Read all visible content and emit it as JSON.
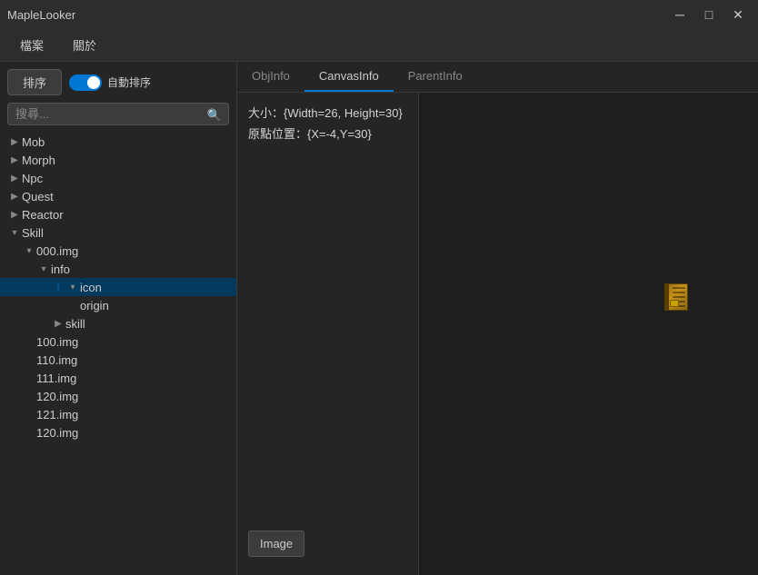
{
  "app": {
    "title": "MapleLooker",
    "minimize_label": "─",
    "maximize_label": "□",
    "close_label": "✕"
  },
  "menubar": {
    "items": [
      {
        "label": "檔案"
      },
      {
        "label": "關於"
      }
    ]
  },
  "toolbar": {
    "sort_button": "排序",
    "auto_sort_label": "自動排序"
  },
  "search": {
    "placeholder": "搜尋..."
  },
  "tree": {
    "items": [
      {
        "id": "mob",
        "label": "Mob",
        "indent": 0,
        "arrow": "▶",
        "expanded": false
      },
      {
        "id": "morph",
        "label": "Morph",
        "indent": 0,
        "arrow": "▶",
        "expanded": false
      },
      {
        "id": "npc",
        "label": "Npc",
        "indent": 0,
        "arrow": "▶",
        "expanded": false
      },
      {
        "id": "quest",
        "label": "Quest",
        "indent": 0,
        "arrow": "▶",
        "expanded": false
      },
      {
        "id": "reactor",
        "label": "Reactor",
        "indent": 0,
        "arrow": "▶",
        "expanded": false
      },
      {
        "id": "skill",
        "label": "Skill",
        "indent": 0,
        "arrow": "▾",
        "expanded": true
      },
      {
        "id": "000img",
        "label": "000.img",
        "indent": 1,
        "arrow": "▾",
        "expanded": true
      },
      {
        "id": "info",
        "label": "info",
        "indent": 2,
        "arrow": "▾",
        "expanded": true
      },
      {
        "id": "icon",
        "label": "icon",
        "indent": 3,
        "arrow": "▾",
        "expanded": true,
        "selected": true
      },
      {
        "id": "origin",
        "label": "origin",
        "indent": 4,
        "arrow": "",
        "expanded": false
      },
      {
        "id": "skill2",
        "label": "skill",
        "indent": 3,
        "arrow": "▶",
        "expanded": false
      },
      {
        "id": "100img",
        "label": "100.img",
        "indent": 1,
        "arrow": "",
        "expanded": false
      },
      {
        "id": "110img",
        "label": "110.img",
        "indent": 1,
        "arrow": "",
        "expanded": false
      },
      {
        "id": "111img",
        "label": "111.img",
        "indent": 1,
        "arrow": "",
        "expanded": false
      },
      {
        "id": "120img",
        "label": "120.img",
        "indent": 1,
        "arrow": "",
        "expanded": false
      },
      {
        "id": "121img",
        "label": "121.img",
        "indent": 1,
        "arrow": "",
        "expanded": false
      },
      {
        "id": "130img",
        "label": "120.img",
        "indent": 1,
        "arrow": "",
        "expanded": false
      }
    ]
  },
  "tabs": {
    "items": [
      {
        "id": "objinfo",
        "label": "ObjInfo"
      },
      {
        "id": "canvasinfo",
        "label": "CanvasInfo",
        "active": true
      },
      {
        "id": "parentinfo",
        "label": "ParentInfo"
      }
    ]
  },
  "canvas_info": {
    "size_label": "大小：{Width=26, Height=30}",
    "origin_label": "原點位置：{X=-4,Y=30}"
  },
  "image_section": {
    "label": "Image"
  }
}
